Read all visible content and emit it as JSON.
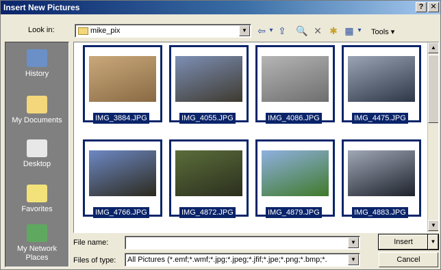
{
  "window": {
    "title": "Insert New Pictures",
    "help_glyph": "?",
    "close_glyph": "✕"
  },
  "look_in": {
    "label": "Look in:",
    "value": "mike_pix"
  },
  "toolbar": {
    "back_glyph": "⇦",
    "dropdown_glyph": "▾",
    "up_glyph": "⇪",
    "search_glyph": "🔍",
    "delete_glyph": "✕",
    "new_folder_glyph": "✱",
    "views_glyph": "▦",
    "tools_label": "Tools"
  },
  "places": [
    {
      "label": "History",
      "icon": "history-icon",
      "color": "#6b8fc7"
    },
    {
      "label": "My Documents",
      "icon": "my-documents-icon",
      "color": "#f3d77a"
    },
    {
      "label": "Desktop",
      "icon": "desktop-icon",
      "color": "#e8e8e8"
    },
    {
      "label": "Favorites",
      "icon": "favorites-icon",
      "color": "#f3e27a"
    },
    {
      "label": "My Network Places",
      "icon": "network-icon",
      "color": "#5fa85f"
    }
  ],
  "files": [
    {
      "name": "IMG_3884.JPG",
      "colors": [
        "#c9a97a",
        "#8a6a44"
      ]
    },
    {
      "name": "IMG_4055.JPG",
      "colors": [
        "#7d8fb5",
        "#3e3a2f"
      ]
    },
    {
      "name": "IMG_4086.JPG",
      "colors": [
        "#b5b5b5",
        "#6e6e6e"
      ]
    },
    {
      "name": "IMG_4475.JPG",
      "colors": [
        "#9aa4b4",
        "#2d3748"
      ]
    },
    {
      "name": "IMG_4766.JPG",
      "colors": [
        "#6d88c4",
        "#2c2a1d"
      ]
    },
    {
      "name": "IMG_4872.JPG",
      "colors": [
        "#5b6d3a",
        "#2b2f1e"
      ]
    },
    {
      "name": "IMG_4879.JPG",
      "colors": [
        "#8fb0e0",
        "#3f7a2a"
      ]
    },
    {
      "name": "IMG_4883.JPG",
      "colors": [
        "#a0a7b5",
        "#1d222c"
      ]
    }
  ],
  "file_name": {
    "label": "File name:",
    "value": ""
  },
  "file_type": {
    "label": "Files of type:",
    "value": "All Pictures (*.emf;*.wmf;*.jpg;*.jpeg;*.jfif;*.jpe;*.png;*.bmp;*."
  },
  "buttons": {
    "insert": "Insert",
    "cancel": "Cancel"
  },
  "colors": {
    "title_bar": "#0a246a",
    "selection": "#0a246a",
    "places_bar": "#808080"
  }
}
